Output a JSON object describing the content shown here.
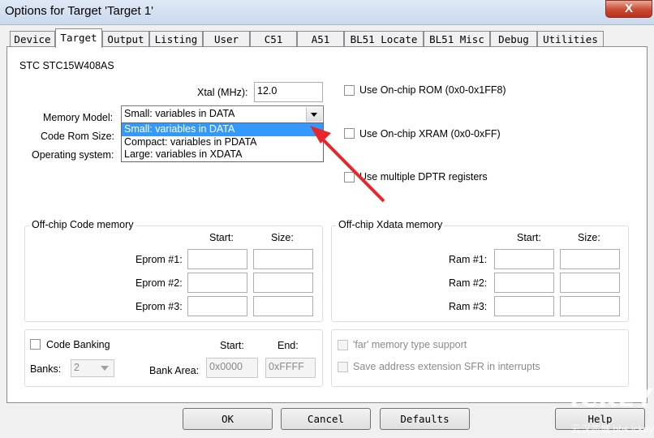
{
  "window": {
    "title": "Options for Target 'Target 1'",
    "close_glyph": "X"
  },
  "tabs": [
    {
      "label": "Device"
    },
    {
      "label": "Target"
    },
    {
      "label": "Output"
    },
    {
      "label": "Listing"
    },
    {
      "label": "User"
    },
    {
      "label": "C51"
    },
    {
      "label": "A51"
    },
    {
      "label": "BL51 Locate"
    },
    {
      "label": "BL51 Misc"
    },
    {
      "label": "Debug"
    },
    {
      "label": "Utilities"
    }
  ],
  "active_tab": "Target",
  "target": {
    "device_name": "STC STC15W408AS",
    "xtal_label": "Xtal (MHz):",
    "xtal_value": "12.0",
    "memory_model_label": "Memory Model:",
    "memory_model_value": "Small: variables in DATA",
    "memory_model_options": [
      "Small: variables in DATA",
      "Compact: variables in PDATA",
      "Large: variables in XDATA"
    ],
    "code_rom_label": "Code Rom Size:",
    "os_label": "Operating system:",
    "use_onchip_rom": "Use On-chip ROM (0x0-0x1FF8)",
    "use_onchip_xram": "Use On-chip XRAM (0x0-0xFF)",
    "use_multiple_dptr": "Use multiple DPTR registers"
  },
  "offchip_code": {
    "legend": "Off-chip Code memory",
    "start_header": "Start:",
    "size_header": "Size:",
    "rows": [
      {
        "label": "Eprom #1:"
      },
      {
        "label": "Eprom #2:"
      },
      {
        "label": "Eprom #3:"
      }
    ]
  },
  "offchip_xdata": {
    "legend": "Off-chip Xdata memory",
    "start_header": "Start:",
    "size_header": "Size:",
    "rows": [
      {
        "label": "Ram #1:"
      },
      {
        "label": "Ram #2:"
      },
      {
        "label": "Ram #3:"
      }
    ]
  },
  "banking": {
    "code_banking_label": "Code Banking",
    "banks_label": "Banks:",
    "banks_value": "2",
    "start_header": "Start:",
    "end_header": "End:",
    "bank_area_label": "Bank Area:",
    "bank_area_start": "0x0000",
    "bank_area_end": "0xFFFF",
    "far_memory_label": "'far' memory type support",
    "save_address_label": "Save address extension SFR in interrupts"
  },
  "buttons": {
    "ok": "OK",
    "cancel": "Cancel",
    "defaults": "Defaults",
    "help": "Help"
  },
  "watermark": {
    "logo": "ICKEY",
    "sub": "云汉芯城 bbs.ickey.cn"
  },
  "colors": {
    "selection": "#3399ff",
    "arrow": "#e8262a"
  }
}
